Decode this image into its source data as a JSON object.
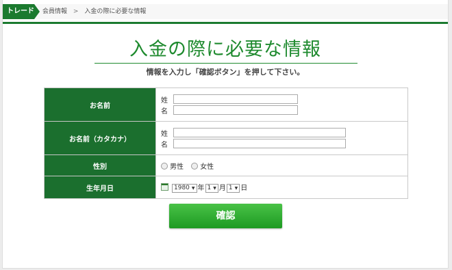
{
  "breadcrumb": {
    "tag": "トレード",
    "items": [
      "会員情報",
      ">",
      "入金の際に必要な情報"
    ]
  },
  "header": {
    "title": "入金の際に必要な情報",
    "subtitle": "情報を入力し「確認ボタン」を押して下さい。"
  },
  "form": {
    "name": {
      "label": "お名前",
      "sei": "姓",
      "mei": "名",
      "sei_value": "",
      "mei_value": ""
    },
    "kana": {
      "label": "お名前（カタカナ）",
      "sei": "姓",
      "mei": "名",
      "sei_value": "",
      "mei_value": ""
    },
    "gender": {
      "label": "性別",
      "options": [
        "男性",
        "女性"
      ]
    },
    "birth": {
      "label": "生年月日",
      "year": "1980",
      "year_unit": "年",
      "month": "1",
      "month_unit": "月",
      "day": "1",
      "day_unit": "日"
    }
  },
  "confirm_label": "確認",
  "colors": {
    "accent": "#1b7a2f",
    "button": "#2aa82b",
    "title": "#1e8a2e"
  }
}
